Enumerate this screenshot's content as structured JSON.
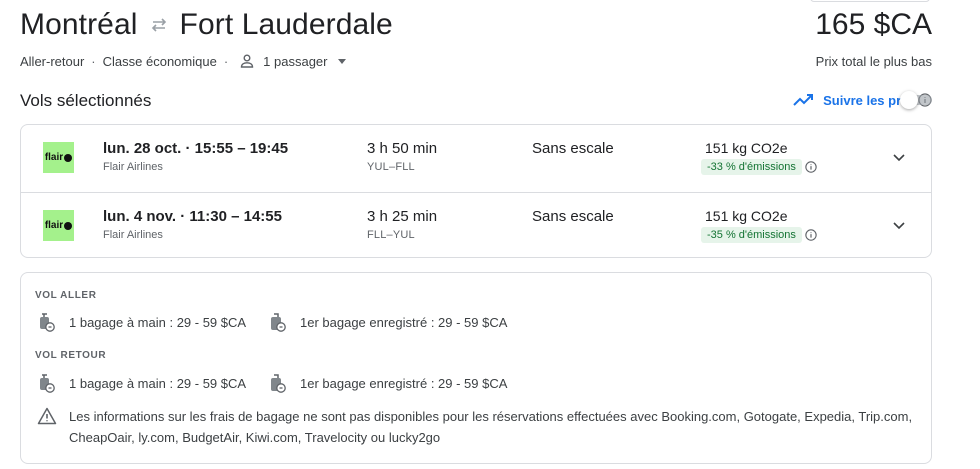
{
  "route": {
    "origin": "Montréal",
    "destination": "Fort Lauderdale",
    "swap_icon": "swap-horiz-icon"
  },
  "price": {
    "amount": "165 $CA",
    "label": "Prix total le plus bas"
  },
  "trip_meta": {
    "trip_type": "Aller-retour",
    "cabin": "Classe économique",
    "passengers": "1 passager",
    "separator": "·"
  },
  "selected": {
    "title": "Vols sélectionnés",
    "track_label": "Suivre les prix",
    "track_enabled": false
  },
  "flights": [
    {
      "airline_logo_text": "flair",
      "times": "lun. 28 oct.  ·  15:55 – 19:45",
      "airline": "Flair Airlines",
      "duration": "3 h 50 min",
      "codes": "YUL–FLL",
      "stops": "Sans escale",
      "co2": "151 kg CO2e",
      "emissions": "-33 % d'émissions"
    },
    {
      "airline_logo_text": "flair",
      "times": "lun. 4 nov.  ·  11:30 – 14:55",
      "airline": "Flair Airlines",
      "duration": "3 h 25 min",
      "codes": "FLL–YUL",
      "stops": "Sans escale",
      "co2": "151 kg CO2e",
      "emissions": "-35 % d'émissions"
    }
  ],
  "baggage": {
    "outbound_title": "VOL ALLER",
    "return_title": "VOL RETOUR",
    "carry_on": "1 bagage à main : 29 - 59 $CA",
    "checked": "1er bagage enregistré : 29 - 59 $CA",
    "notice": "Les informations sur les frais de bagage ne sont pas disponibles pour les réservations effectuées avec Booking.com, Gotogate, Expedia, Trip.com, CheapOair, ly.com, BudgetAir, Kiwi.com, Travelocity ou lucky2go"
  },
  "colors": {
    "accent": "#1a73e8",
    "emissions_bg": "#e6f4ea",
    "emissions_text": "#137333",
    "logo_bg": "#a4f18c"
  }
}
